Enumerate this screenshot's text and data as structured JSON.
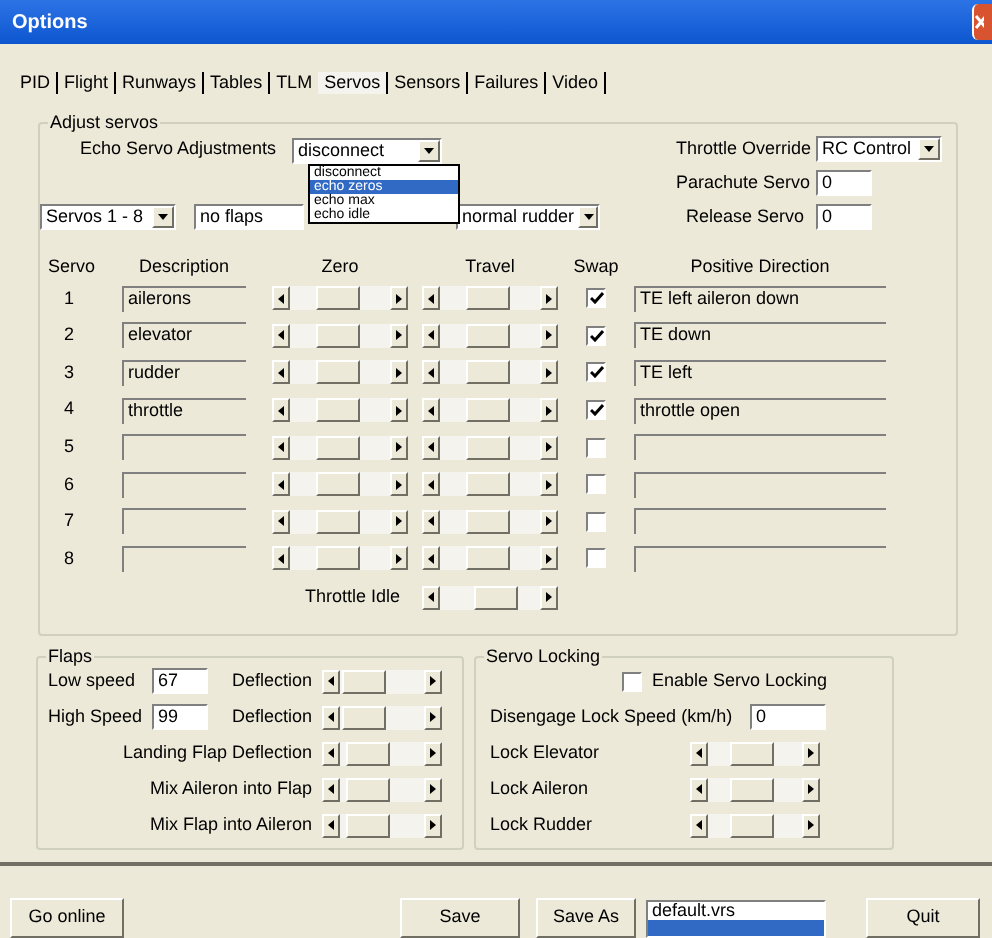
{
  "window": {
    "title": "Options"
  },
  "tabs": [
    {
      "label": "PID",
      "selected": false
    },
    {
      "label": "Flight",
      "selected": false
    },
    {
      "label": "Runways",
      "selected": false
    },
    {
      "label": "Tables",
      "selected": false
    },
    {
      "label": "TLM",
      "selected": false
    },
    {
      "label": "Servos",
      "selected": true
    },
    {
      "label": "Sensors",
      "selected": false
    },
    {
      "label": "Failures",
      "selected": false
    },
    {
      "label": "Video",
      "selected": false
    }
  ],
  "adjust_servos": {
    "title": "Adjust servos",
    "echo_label": "Echo Servo Adjustments",
    "echo_select": "disconnect",
    "echo_options": [
      {
        "label": "disconnect",
        "selected": false
      },
      {
        "label": "echo zeros",
        "selected": true
      },
      {
        "label": "echo max",
        "selected": false
      },
      {
        "label": "echo idle",
        "selected": false
      }
    ],
    "servo_bank_select": "Servos 1 - 8",
    "flaps_select": "no flaps",
    "rudder_select": "normal rudder",
    "throttle_override": {
      "label": "Throttle Override",
      "value": "RC Control"
    },
    "parachute_servo": {
      "label": "Parachute Servo",
      "value": "0"
    },
    "release_servo": {
      "label": "Release Servo",
      "value": "0"
    },
    "columns": [
      "Servo",
      "Description",
      "Zero",
      "Travel",
      "Swap",
      "Positive Direction"
    ],
    "servos": [
      {
        "number": "1",
        "description": "ailerons",
        "swap": {
          "checked": true
        },
        "positive_direction": "TE left aileron down"
      },
      {
        "number": "2",
        "description": "elevator",
        "swap": {
          "checked": true
        },
        "positive_direction": "TE down"
      },
      {
        "number": "3",
        "description": "rudder",
        "swap": {
          "checked": true
        },
        "positive_direction": "TE left"
      },
      {
        "number": "4",
        "description": "throttle",
        "swap": {
          "checked": true
        },
        "positive_direction": "throttle open"
      },
      {
        "number": "5",
        "swap": {
          "checked": false
        }
      },
      {
        "number": "6",
        "swap": {
          "checked": false
        }
      },
      {
        "number": "7",
        "swap": {
          "checked": false
        }
      },
      {
        "number": "8",
        "swap": {
          "checked": false
        }
      }
    ],
    "throttle_idle": {
      "label": "Throttle Idle"
    }
  },
  "flaps": {
    "title": "Flaps",
    "rows": [
      {
        "kind": "speed",
        "label": "Low speed",
        "value": "67",
        "slider_label": "Deflection"
      },
      {
        "kind": "speed",
        "label": "High Speed",
        "value": "99",
        "slider_label": "Deflection"
      },
      {
        "kind": "slider",
        "label": "Landing Flap Deflection"
      },
      {
        "kind": "slider",
        "label": "Mix Aileron into Flap"
      },
      {
        "kind": "slider",
        "label": "Mix Flap into Aileron"
      }
    ]
  },
  "servo_locking": {
    "title": "Servo Locking",
    "enable": {
      "label": "Enable Servo Locking",
      "checked": false
    },
    "disengage": {
      "label": "Disengage Lock Speed (km/h)",
      "value": "0"
    },
    "locks": [
      {
        "label": "Lock Elevator"
      },
      {
        "label": "Lock Aileron"
      },
      {
        "label": "Lock Rudder"
      }
    ]
  },
  "bottom": {
    "go_online": "Go online",
    "save": "Save",
    "save_as": "Save As",
    "quit": "Quit",
    "files": [
      {
        "label": "default.vrs",
        "selected": false
      },
      {
        "selected": true
      }
    ]
  }
}
